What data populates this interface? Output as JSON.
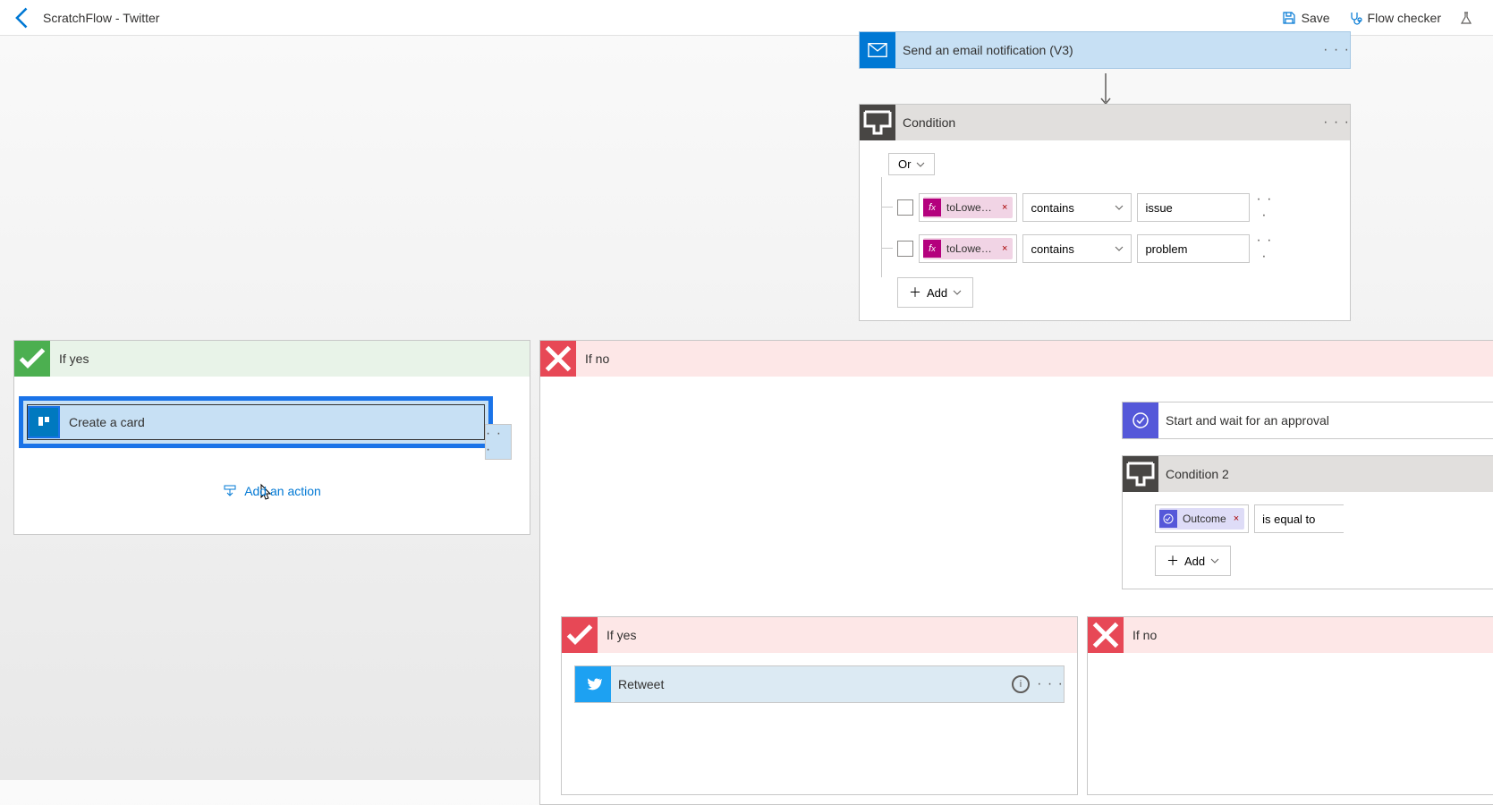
{
  "header": {
    "title": "ScratchFlow - Twitter",
    "save": "Save",
    "flow_checker": "Flow checker"
  },
  "email_action": {
    "title": "Send an email notification (V3)"
  },
  "condition1": {
    "title": "Condition",
    "group_op": "Or",
    "rows": [
      {
        "token": "toLower(...",
        "op": "contains",
        "value": "issue"
      },
      {
        "token": "toLower(...",
        "op": "contains",
        "value": "problem"
      }
    ],
    "add": "Add"
  },
  "branches": {
    "yes_label": "If yes",
    "no_label": "If no"
  },
  "trello": {
    "title": "Create a card"
  },
  "add_action": "Add an action",
  "approval": {
    "title": "Start and wait for an approval"
  },
  "condition2": {
    "title": "Condition 2",
    "token": "Outcome",
    "op": "is equal to",
    "add": "Add"
  },
  "retweet": {
    "title": "Retweet"
  }
}
